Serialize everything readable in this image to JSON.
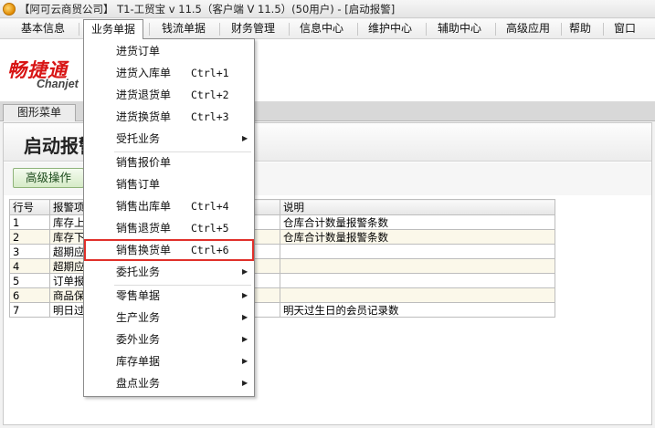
{
  "window": {
    "title": "【阿可云商贸公司】 T1-工贸宝 v 11.5（客户端 V 11.5）(50用户) - [启动报警]"
  },
  "menubar": {
    "items": [
      "基本信息",
      "业务单据",
      "钱流单据",
      "财务管理",
      "信息中心",
      "维护中心",
      "辅助中心",
      "高级应用",
      "帮助",
      "窗口"
    ],
    "active": "业务单据"
  },
  "logo": {
    "cn_text": "畅捷通",
    "en_text": "Chanjet"
  },
  "tabs": {
    "graphic_menu": "图形菜单"
  },
  "page": {
    "title": "启动报警",
    "advanced_button": "高级操作"
  },
  "table": {
    "columns": [
      "行号",
      "报警项目",
      "",
      "说明"
    ],
    "rows": [
      {
        "no": "1",
        "item": "库存上限报警",
        "desc": "仓库合计数量报警条数"
      },
      {
        "no": "2",
        "item": "库存下限报警",
        "desc": "仓库合计数量报警条数"
      },
      {
        "no": "3",
        "item": "超期应收款",
        "desc": ""
      },
      {
        "no": "4",
        "item": "超期应付款",
        "desc": ""
      },
      {
        "no": "5",
        "item": "订单报警",
        "desc": ""
      },
      {
        "no": "6",
        "item": "商品保质期",
        "desc": ""
      },
      {
        "no": "7",
        "item": "明日过生日的会员",
        "desc": "明天过生日的会员记录数"
      }
    ]
  },
  "dropdown": {
    "items": [
      {
        "label": "进货订单",
        "shortcut": "",
        "submenu": false
      },
      {
        "label": "进货入库单",
        "shortcut": "Ctrl+1",
        "submenu": false
      },
      {
        "label": "进货退货单",
        "shortcut": "Ctrl+2",
        "submenu": false
      },
      {
        "label": "进货换货单",
        "shortcut": "Ctrl+3",
        "submenu": false
      },
      {
        "label": "受托业务",
        "shortcut": "",
        "submenu": true
      },
      {
        "label": "销售报价单",
        "shortcut": "",
        "submenu": false
      },
      {
        "label": "销售订单",
        "shortcut": "",
        "submenu": false
      },
      {
        "label": "销售出库单",
        "shortcut": "Ctrl+4",
        "submenu": false
      },
      {
        "label": "销售退货单",
        "shortcut": "Ctrl+5",
        "submenu": false
      },
      {
        "label": "销售换货单",
        "shortcut": "Ctrl+6",
        "submenu": false,
        "highlighted": true
      },
      {
        "label": "委托业务",
        "shortcut": "",
        "submenu": true
      },
      {
        "label": "零售单据",
        "shortcut": "",
        "submenu": true
      },
      {
        "label": "生产业务",
        "shortcut": "",
        "submenu": true
      },
      {
        "label": "委外业务",
        "shortcut": "",
        "submenu": true
      },
      {
        "label": "库存单据",
        "shortcut": "",
        "submenu": true
      },
      {
        "label": "盘点业务",
        "shortcut": "",
        "submenu": true
      }
    ]
  },
  "colors": {
    "highlight_border": "#e0302a",
    "logo_red": "#d81515",
    "even_row": "#fbf8ea",
    "advanced_button": "#d6ebc7"
  }
}
